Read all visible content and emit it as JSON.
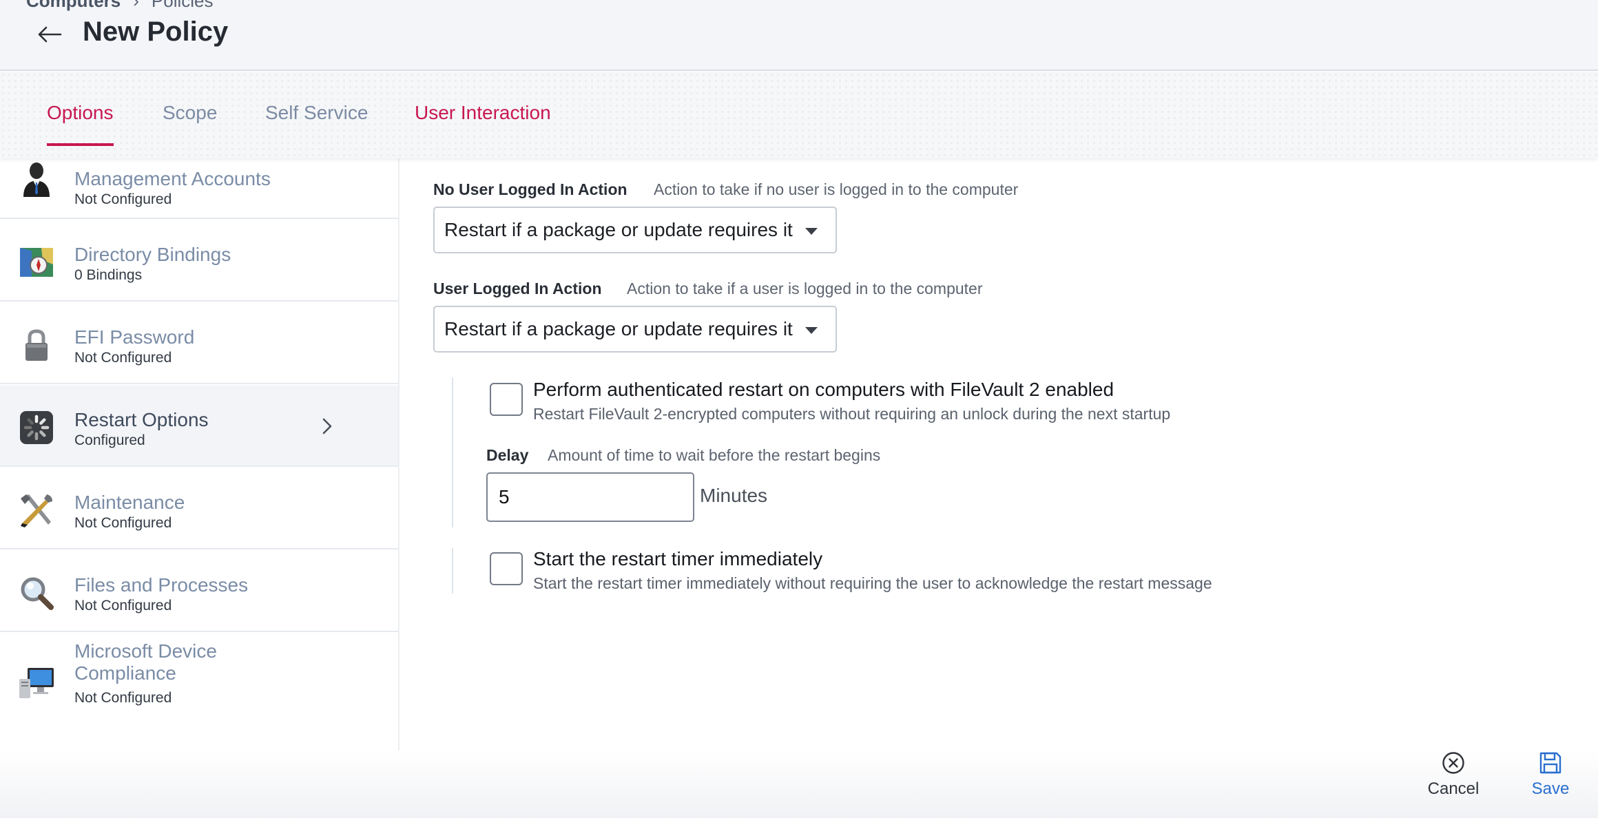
{
  "header": {
    "breadcrumb": [
      "Computers",
      "Policies"
    ],
    "title": "New Policy"
  },
  "tabs": [
    {
      "label": "Options",
      "state": "active"
    },
    {
      "label": "Scope",
      "state": "normal"
    },
    {
      "label": "Self Service",
      "state": "normal"
    },
    {
      "label": "User Interaction",
      "state": "alert"
    }
  ],
  "sidebar": {
    "items": [
      {
        "title": "Management Accounts",
        "status": "Not Configured",
        "icon": "person-icon"
      },
      {
        "title": "Directory Bindings",
        "status": "0 Bindings",
        "icon": "map-compass-icon"
      },
      {
        "title": "EFI Password",
        "status": "Not Configured",
        "icon": "padlock-icon"
      },
      {
        "title": "Restart Options",
        "status": "Configured",
        "icon": "restart-spinner-icon"
      },
      {
        "title": "Maintenance",
        "status": "Not Configured",
        "icon": "tools-icon"
      },
      {
        "title": "Files and Processes",
        "status": "Not Configured",
        "icon": "magnifier-icon"
      },
      {
        "title": "Microsoft Device Compliance",
        "status": "Not Configured",
        "icon": "computer-icon"
      }
    ],
    "selected": "Restart Options"
  },
  "restart": {
    "no_user_label": "No User Logged In Action",
    "no_user_help": "Action to take if no user is logged in to the computer",
    "no_user_value": "Restart if a package or update requires it",
    "user_label": "User Logged In Action",
    "user_help": "Action to take if a user is logged in to the computer",
    "user_value": "Restart if a package or update requires it",
    "filevault_title": "Perform authenticated restart on computers with FileVault 2 enabled",
    "filevault_help": "Restart FileVault 2-encrypted computers without requiring an unlock during the next startup",
    "filevault_checked": false,
    "delay_label": "Delay",
    "delay_help": "Amount of time to wait before the restart begins",
    "delay_value": "5",
    "delay_unit": "Minutes",
    "timer_title": "Start the restart timer immediately",
    "timer_help": "Start the restart timer immediately without requiring the user to acknowledge the restart message",
    "timer_checked": false
  },
  "footer": {
    "cancel": "Cancel",
    "save": "Save"
  },
  "colors": {
    "accent": "#c8174f",
    "link": "#2a6fcf",
    "sidebar_text": "#7a8ca6"
  }
}
